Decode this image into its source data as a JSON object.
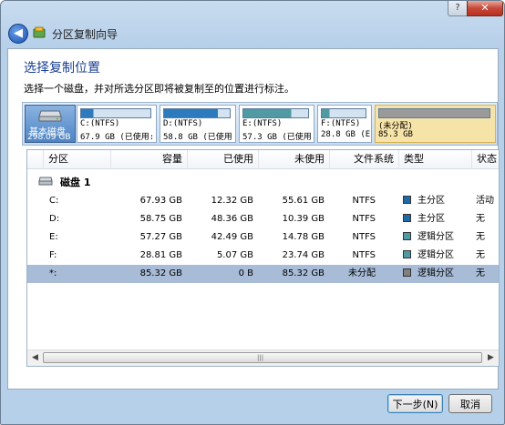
{
  "window": {
    "title": "分区复制向导",
    "help_label": "?",
    "close_label": "✕",
    "back_label": "◀"
  },
  "page": {
    "heading": "选择复制位置",
    "instruction": "选择一个磁盘，并对所选分区即将被复制至的位置进行标注。"
  },
  "diskmap": {
    "disk_name": "基本磁盘",
    "disk_size": "298.09 GB",
    "partitions": [
      {
        "line1": "C:(NTFS)",
        "line2": "67.9 GB (已使用:",
        "fill_color": "#2c7bbf",
        "used_fraction": 0.18,
        "selected": false
      },
      {
        "line1": "D:(NTFS)",
        "line2": "58.8 GB (已使用",
        "fill_color": "#2c7bbf",
        "used_fraction": 0.82,
        "selected": false
      },
      {
        "line1": "E:(NTFS)",
        "line2": "57.3 GB (已使用",
        "fill_color": "#4f9aa3",
        "used_fraction": 0.74,
        "selected": false
      },
      {
        "line1": "F:(NTFS)",
        "line2": "28.8 GB (E",
        "fill_color": "#4f9aa3",
        "used_fraction": 0.18,
        "selected": false
      },
      {
        "line1": "(未分配)",
        "line2": "85.3 GB",
        "fill_color": "#9a9a9a",
        "used_fraction": 1.0,
        "selected": true
      }
    ]
  },
  "table": {
    "headers": [
      "分区",
      "容量",
      "已使用",
      "未使用",
      "文件系统",
      "类型",
      "状态"
    ],
    "group_label": "磁盘 1",
    "rows": [
      {
        "partition": "C:",
        "capacity": "67.93 GB",
        "used": "12.32 GB",
        "unused": "55.61 GB",
        "fs": "NTFS",
        "type": "主分区",
        "type_color": "#1f6aa6",
        "status": "活动",
        "selected": false
      },
      {
        "partition": "D:",
        "capacity": "58.75 GB",
        "used": "48.36 GB",
        "unused": "10.39 GB",
        "fs": "NTFS",
        "type": "主分区",
        "type_color": "#1f6aa6",
        "status": "无",
        "selected": false
      },
      {
        "partition": "E:",
        "capacity": "57.27 GB",
        "used": "42.49 GB",
        "unused": "14.78 GB",
        "fs": "NTFS",
        "type": "逻辑分区",
        "type_color": "#4f9aa3",
        "status": "无",
        "selected": false
      },
      {
        "partition": "F:",
        "capacity": "28.81 GB",
        "used": "5.07 GB",
        "unused": "23.74 GB",
        "fs": "NTFS",
        "type": "逻辑分区",
        "type_color": "#4f9aa3",
        "status": "无",
        "selected": false
      },
      {
        "partition": "*:",
        "capacity": "85.32 GB",
        "used": "0 B",
        "unused": "85.32 GB",
        "fs": "未分配",
        "type": "逻辑分区",
        "type_color": "#808080",
        "status": "无",
        "selected": true
      }
    ]
  },
  "buttons": {
    "next": "下一步(N)",
    "cancel": "取消"
  },
  "scroll": {
    "left_arrow": "◀",
    "right_arrow": "▶",
    "grip": "|||"
  }
}
